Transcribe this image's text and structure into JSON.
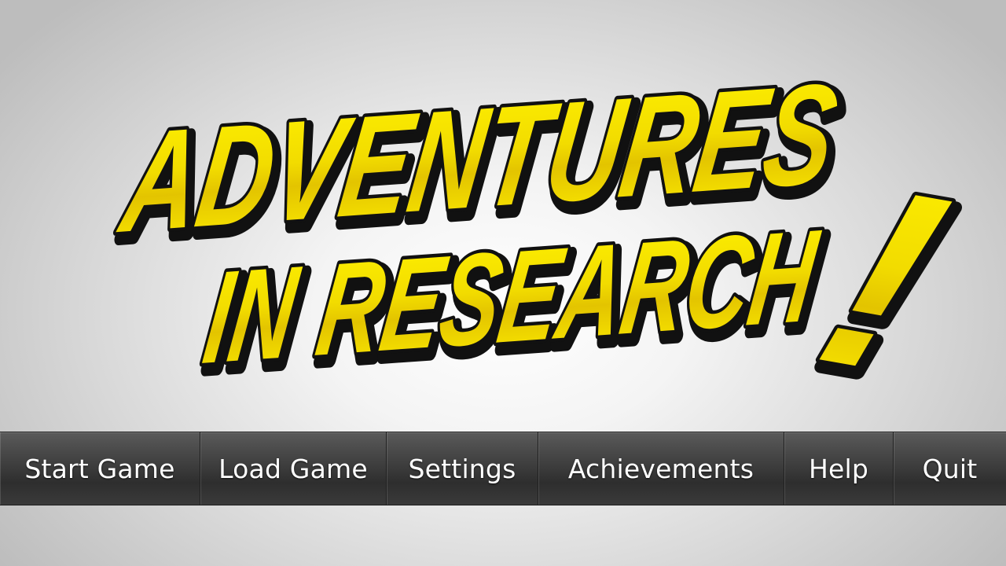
{
  "game": {
    "title_line1": "ADVENTURES",
    "title_line2": "IN RESEARCH",
    "title_exclaim": "!"
  },
  "menu": {
    "items": [
      {
        "label": "Start Game"
      },
      {
        "label": "Load Game"
      },
      {
        "label": "Settings"
      },
      {
        "label": "Achievements"
      },
      {
        "label": "Help"
      },
      {
        "label": "Quit"
      }
    ]
  },
  "colors": {
    "title_fill": "#f7e600",
    "title_outline": "#111111",
    "menu_bar": "#3f3f3f",
    "menu_text": "#ffffff"
  }
}
